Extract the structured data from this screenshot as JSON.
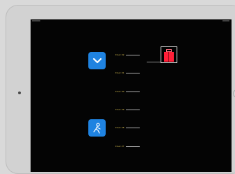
{
  "device": {
    "name": "tablet-simulator"
  },
  "elevator_app": {
    "floors": [
      {
        "label": "Floor 32"
      },
      {
        "label": "Floor 31"
      },
      {
        "label": "Floor 30"
      },
      {
        "label": "Floor 29"
      },
      {
        "label": "Floor 28"
      },
      {
        "label": "Floor 27"
      }
    ],
    "buttons": [
      {
        "icon": "chevron-down-icon"
      },
      {
        "icon": "person-icon"
      }
    ],
    "car": {
      "current_floor_label": "Floor 32",
      "color": "#ff1f38"
    },
    "colors": {
      "screen_background": "#040404",
      "button_blue": "#1f83e1",
      "floor_text": "#f0d35a"
    }
  }
}
